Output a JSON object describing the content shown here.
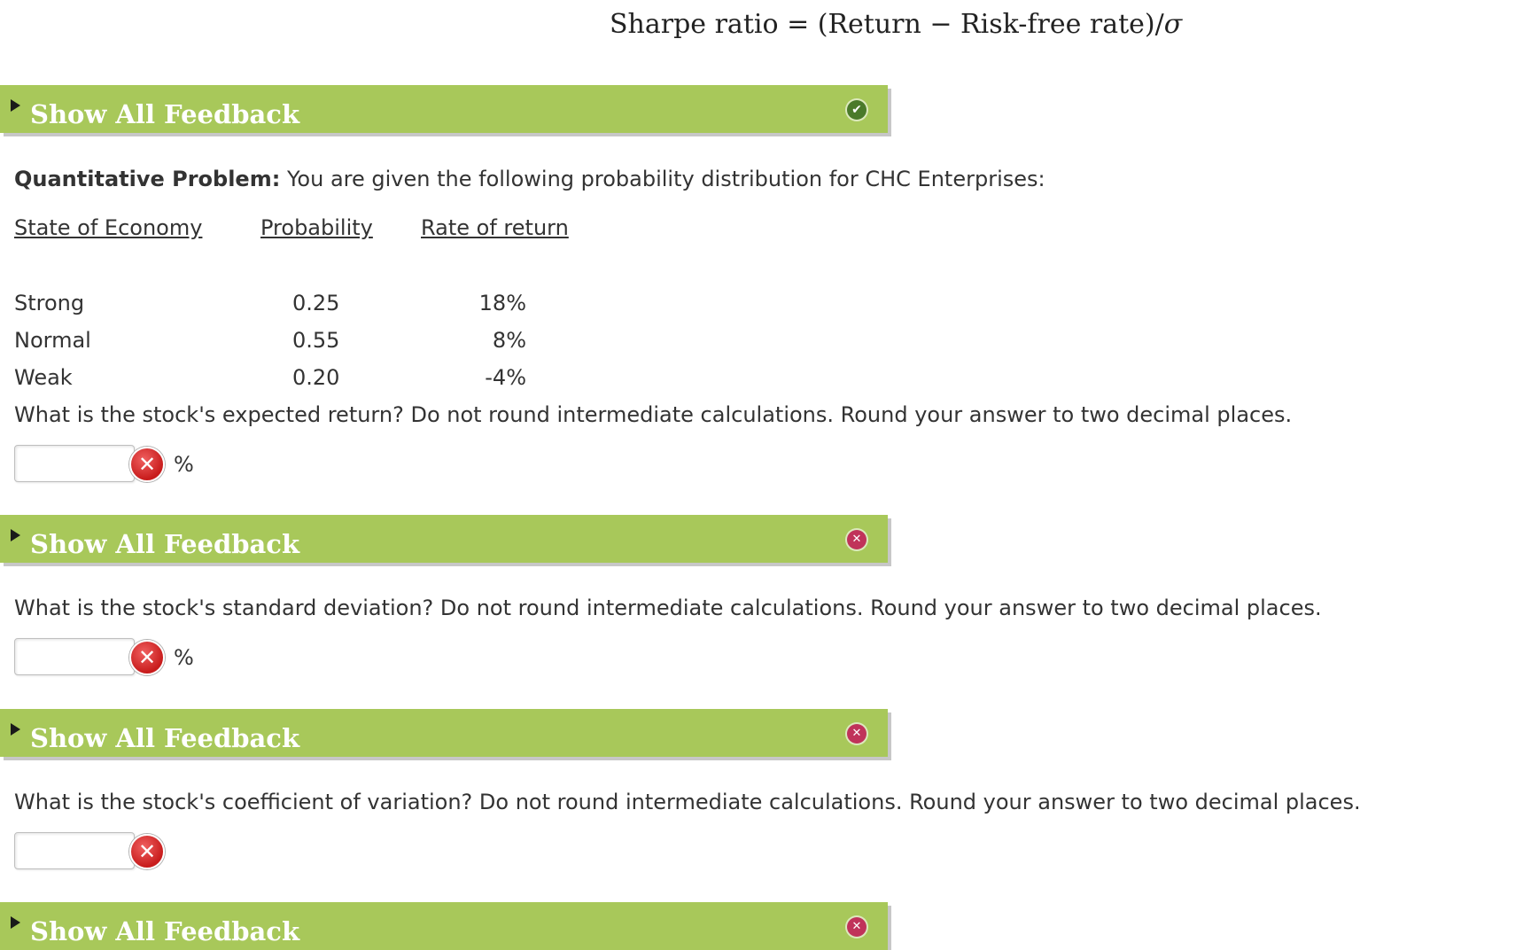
{
  "formula": {
    "text": "Sharpe ratio = (Return − Risk-free rate)/",
    "sigma": "σ"
  },
  "feedback_label": "Show All Feedback",
  "feedback_status": {
    "correct_glyph": "✔",
    "incorrect_glyph": "✕"
  },
  "problem": {
    "label": "Quantitative Problem:",
    "intro": " You are given the following probability distribution for CHC Enterprises:"
  },
  "table": {
    "headers": [
      "State of Economy",
      "Probability",
      "Rate of return"
    ],
    "rows": [
      {
        "state": "Strong",
        "probability": "0.25",
        "rate": "18%"
      },
      {
        "state": "Normal",
        "probability": "0.55",
        "rate": "8%"
      },
      {
        "state": "Weak",
        "probability": "0.20",
        "rate": "-4%"
      }
    ]
  },
  "questions": [
    {
      "text": "What is the stock's expected return? Do not round intermediate calculations. Round your answer to two decimal places.",
      "value": "",
      "unit": "%"
    },
    {
      "text": "What is the stock's standard deviation? Do not round intermediate calculations. Round your answer to two decimal places.",
      "value": "",
      "unit": "%"
    },
    {
      "text": "What is the stock's coefficient of variation? Do not round intermediate calculations. Round your answer to two decimal places.",
      "value": "",
      "unit": ""
    }
  ],
  "wrong_glyph": "✕",
  "colors": {
    "feedback_bar": "#a8c85a",
    "correct": "#4a7a2a",
    "incorrect": "#c0335a"
  }
}
